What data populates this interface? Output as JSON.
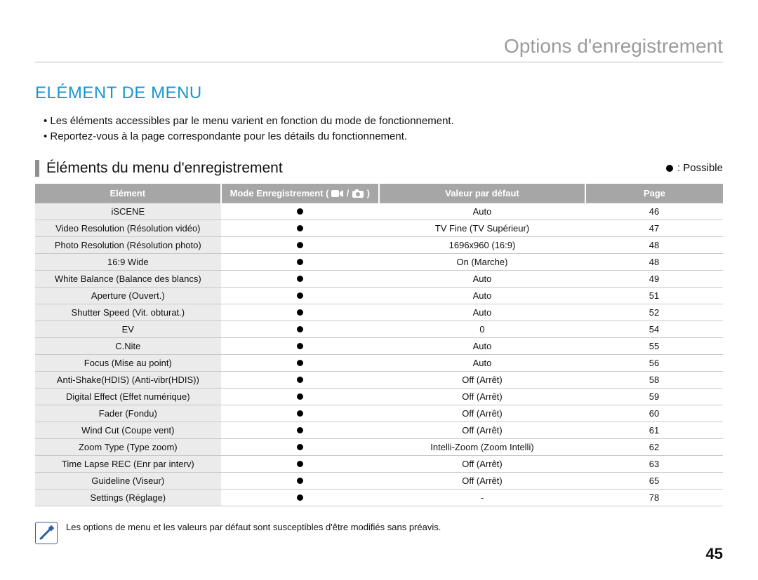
{
  "breadcrumb": "Options d'enregistrement",
  "heading": "ELÉMENT DE MENU",
  "intro": [
    "Les éléments accessibles par le menu varient en fonction du mode de fonctionnement.",
    "Reportez-vous à la page correspondante pour les détails du fonctionnement."
  ],
  "subheading": "Éléments du menu d'enregistrement",
  "legend": {
    "symbol": "●",
    "text": ": Possible"
  },
  "columns": {
    "c1": "Elément",
    "c2_prefix": "Mode Enregistrement (",
    "c2_sep": "/",
    "c2_suffix": ")",
    "c3": "Valeur par défaut",
    "c4": "Page"
  },
  "rows": [
    {
      "element": "iSCENE",
      "default": "Auto",
      "page": "46"
    },
    {
      "element": "Video Resolution (Résolution vidéo)",
      "default": "TV Fine (TV Supérieur)",
      "page": "47"
    },
    {
      "element": "Photo Resolution (Résolution photo)",
      "default": "1696x960 (16:9)",
      "page": "48"
    },
    {
      "element": "16:9 Wide",
      "default": "On (Marche)",
      "page": "48"
    },
    {
      "element": "White Balance (Balance des blancs)",
      "default": "Auto",
      "page": "49"
    },
    {
      "element": "Aperture (Ouvert.)",
      "default": "Auto",
      "page": "51"
    },
    {
      "element": "Shutter Speed (Vit. obturat.)",
      "default": "Auto",
      "page": "52"
    },
    {
      "element": "EV",
      "default": "0",
      "page": "54"
    },
    {
      "element": "C.Nite",
      "default": "Auto",
      "page": "55"
    },
    {
      "element": "Focus (Mise au point)",
      "default": "Auto",
      "page": "56"
    },
    {
      "element": "Anti-Shake(HDIS) (Anti-vibr(HDIS))",
      "default": "Off (Arrêt)",
      "page": "58"
    },
    {
      "element": "Digital Effect (Effet numérique)",
      "default": "Off (Arrêt)",
      "page": "59"
    },
    {
      "element": "Fader (Fondu)",
      "default": "Off (Arrêt)",
      "page": "60"
    },
    {
      "element": "Wind Cut (Coupe vent)",
      "default": "Off (Arrêt)",
      "page": "61"
    },
    {
      "element": "Zoom Type (Type zoom)",
      "default": "Intelli-Zoom (Zoom Intelli)",
      "page": "62"
    },
    {
      "element": "Time Lapse REC (Enr par interv)",
      "default": "Off (Arrêt)",
      "page": "63"
    },
    {
      "element": "Guideline (Viseur)",
      "default": "Off (Arrêt)",
      "page": "65"
    },
    {
      "element": "Settings (Réglage)",
      "default": "-",
      "page": "78"
    }
  ],
  "footnote": "Les options de menu et les valeurs par défaut sont susceptibles d'être modifiés sans préavis.",
  "page_number": "45"
}
